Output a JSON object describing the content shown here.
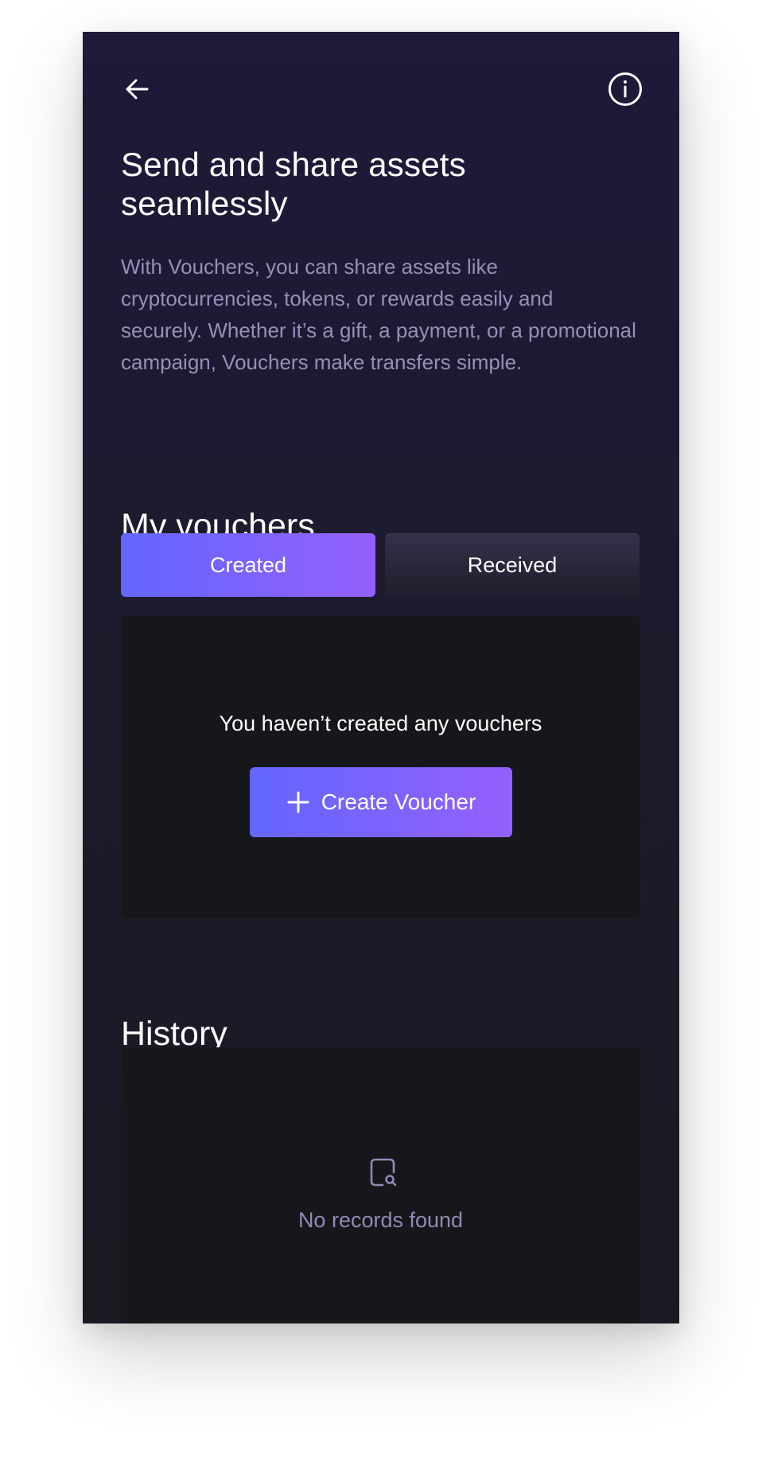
{
  "header": {
    "back_icon": "arrow-left-icon",
    "info_icon": "info-circle-icon"
  },
  "hero": {
    "title": "Send and share assets seamlessly",
    "description": "With Vouchers, you can share assets like cryptocurrencies, tokens, or rewards easily and securely. Whether it’s a gift, a payment, or a promotional campaign, Vouchers make transfers simple."
  },
  "vouchers": {
    "title": "My vouchers",
    "tabs": [
      {
        "label": "Created",
        "active": true
      },
      {
        "label": "Received",
        "active": false
      }
    ],
    "empty_message": "You haven’t created any vouchers",
    "create_button": {
      "label": "Create Voucher",
      "icon": "plus-icon"
    }
  },
  "history": {
    "title": "History",
    "empty_icon": "document-search-icon",
    "empty_message": "No records found"
  },
  "colors": {
    "accent_gradient_start": "#6366ff",
    "accent_gradient_end": "#9560fb",
    "background": "#1c1b2d",
    "panel": "#15171a",
    "muted_text": "#9490b8"
  }
}
